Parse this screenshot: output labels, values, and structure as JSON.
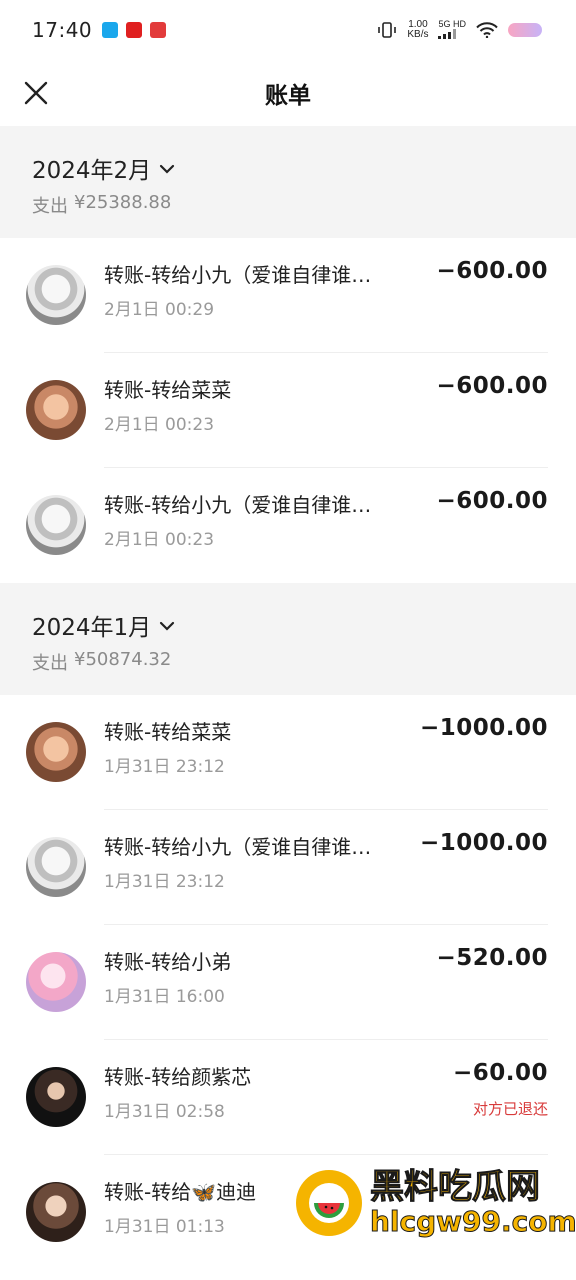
{
  "status_bar": {
    "time": "17:40",
    "net_speed_value": "1.00",
    "net_speed_unit": "KB/s",
    "net_type_top": "5G HD",
    "net_type_bottom": "all",
    "app_colors": [
      "#1aa7ec",
      "#e02020",
      "#e23b3b"
    ]
  },
  "header": {
    "title": "账单"
  },
  "months": [
    {
      "title": "2024年2月",
      "summary_label": "支出",
      "summary_value": "¥25388.88",
      "transactions": [
        {
          "title": "转账-转给小九（爱谁自律谁…",
          "time": "2月1日 00:29",
          "amount": "−600.00",
          "status": "",
          "avatar": "sketch-avatar"
        },
        {
          "title": "转账-转给菜菜",
          "time": "2月1日 00:23",
          "amount": "−600.00",
          "status": "",
          "avatar": "warm-avatar"
        },
        {
          "title": "转账-转给小九（爱谁自律谁…",
          "time": "2月1日 00:23",
          "amount": "−600.00",
          "status": "",
          "avatar": "sketch-avatar"
        }
      ]
    },
    {
      "title": "2024年1月",
      "summary_label": "支出",
      "summary_value": "¥50874.32",
      "transactions": [
        {
          "title": "转账-转给菜菜",
          "time": "1月31日 23:12",
          "amount": "−1000.00",
          "status": "",
          "avatar": "warm-avatar"
        },
        {
          "title": "转账-转给小九（爱谁自律谁…",
          "time": "1月31日 23:12",
          "amount": "−1000.00",
          "status": "",
          "avatar": "sketch-avatar"
        },
        {
          "title": "转账-转给小弟",
          "time": "1月31日 16:00",
          "amount": "−520.00",
          "status": "",
          "avatar": "pink-avatar"
        },
        {
          "title": "转账-转给颜紫芯",
          "time": "1月31日 02:58",
          "amount": "−60.00",
          "status": "对方已退还",
          "avatar": "dark-avatar"
        },
        {
          "title": "转账-转给🦋迪迪",
          "time": "1月31日 01:13",
          "amount": "",
          "status": "",
          "avatar": "brown-avatar"
        }
      ]
    }
  ],
  "watermark": {
    "main_text": "黑料吃瓜网",
    "sub_text": "hlcgw99.com",
    "color": "#f5b400"
  }
}
